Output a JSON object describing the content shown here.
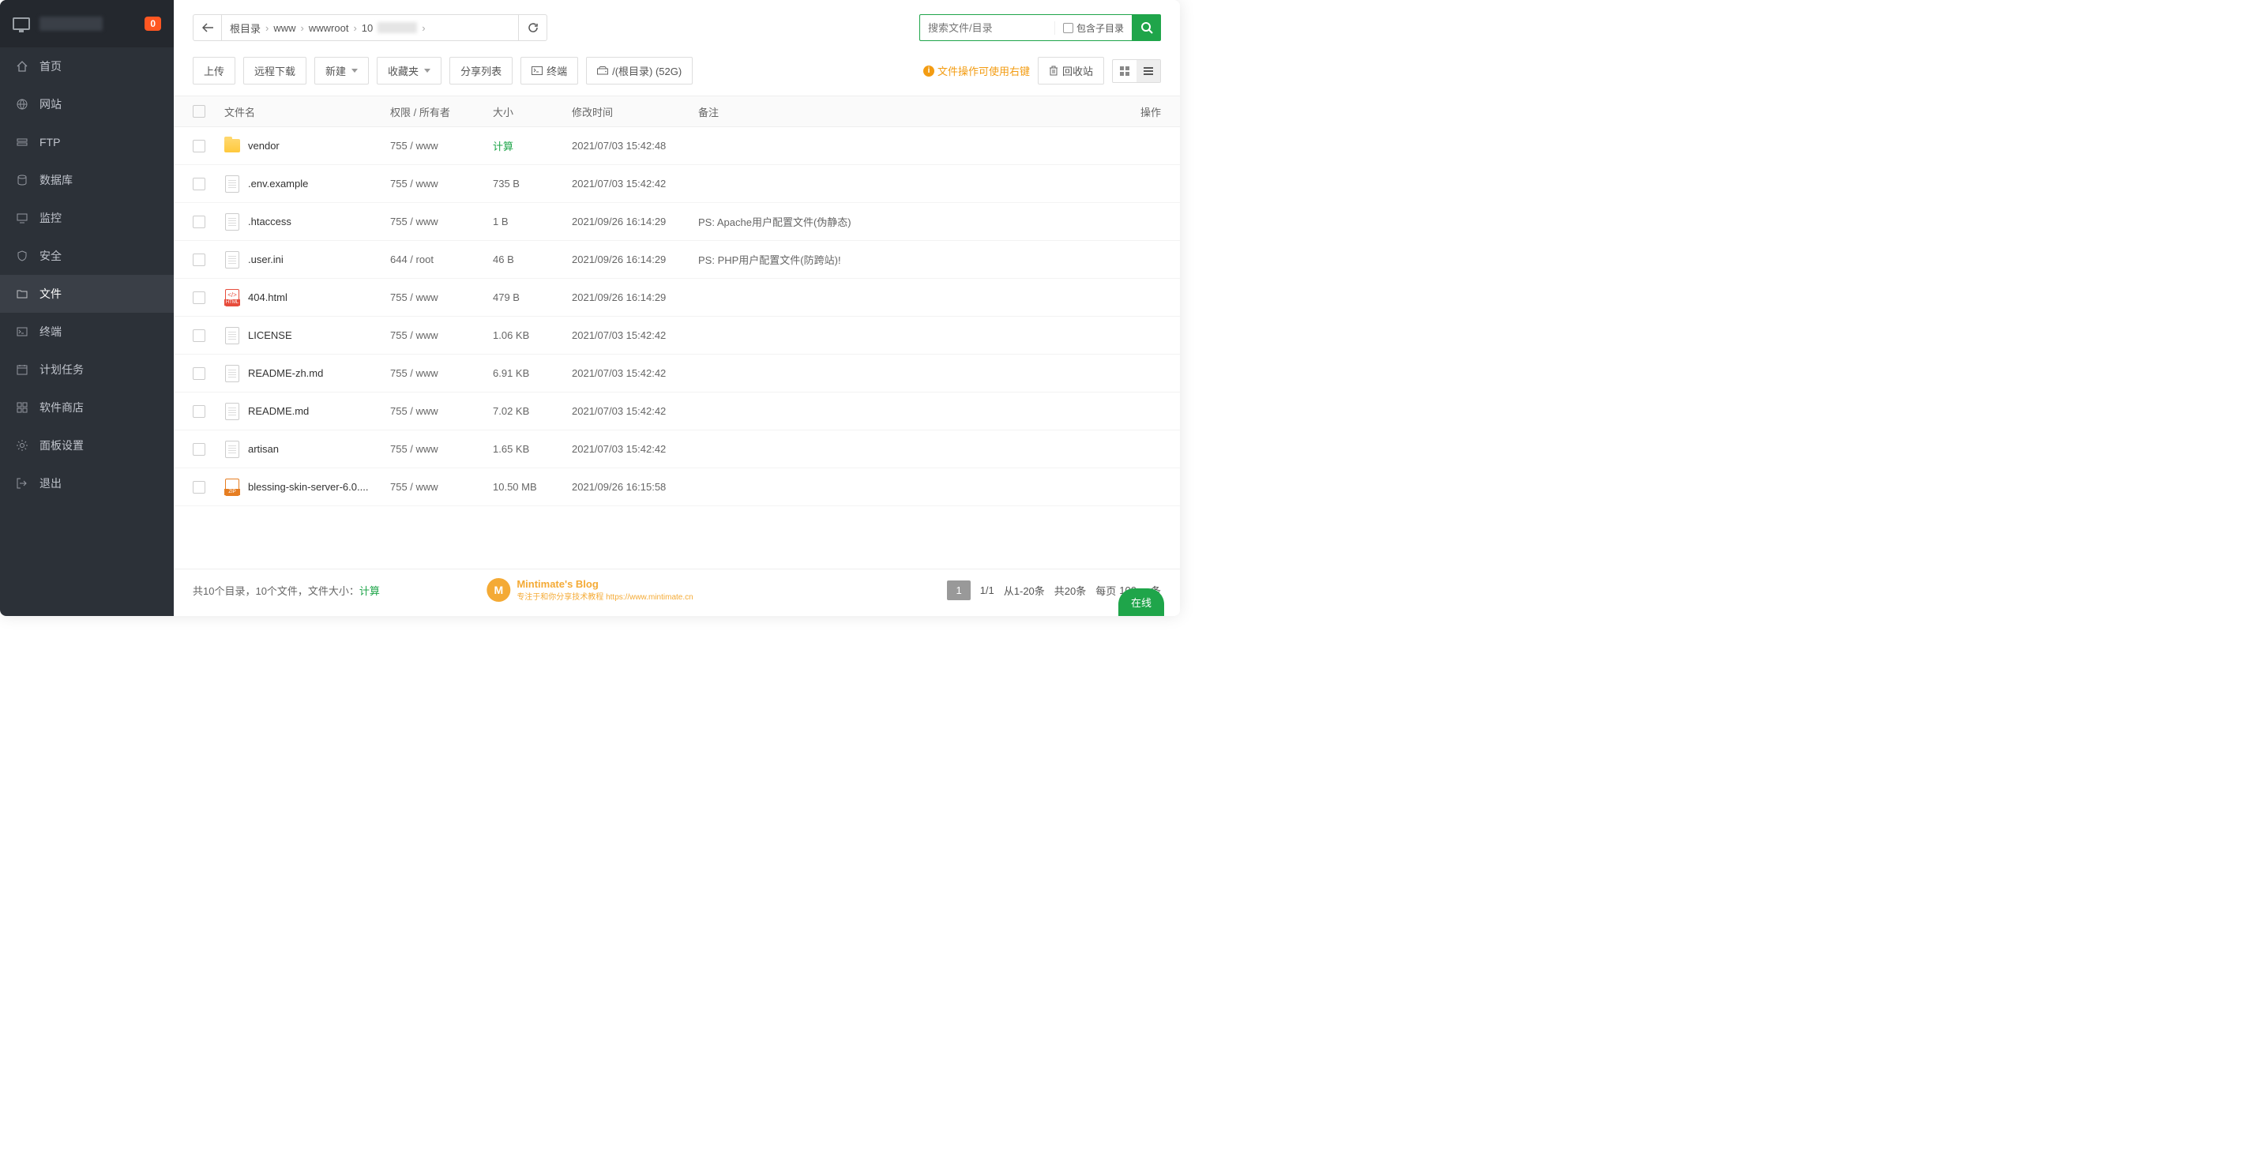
{
  "sidebar": {
    "badge": "0",
    "items": [
      {
        "label": "首页",
        "icon": "home"
      },
      {
        "label": "网站",
        "icon": "globe"
      },
      {
        "label": "FTP",
        "icon": "ftp"
      },
      {
        "label": "数据库",
        "icon": "database"
      },
      {
        "label": "监控",
        "icon": "monitor"
      },
      {
        "label": "安全",
        "icon": "shield"
      },
      {
        "label": "文件",
        "icon": "folder",
        "active": true
      },
      {
        "label": "终端",
        "icon": "terminal"
      },
      {
        "label": "计划任务",
        "icon": "calendar"
      },
      {
        "label": "软件商店",
        "icon": "grid"
      },
      {
        "label": "面板设置",
        "icon": "settings"
      },
      {
        "label": "退出",
        "icon": "logout"
      }
    ]
  },
  "breadcrumb": {
    "segments": [
      "根目录",
      "www",
      "wwwroot",
      "10"
    ],
    "last_blurred": true
  },
  "search": {
    "placeholder": "搜索文件/目录",
    "subdir_label": "包含子目录"
  },
  "toolbar": {
    "upload": "上传",
    "remote_download": "远程下载",
    "new": "新建",
    "favorites": "收藏夹",
    "share_list": "分享列表",
    "terminal": "终端",
    "disk": "/(根目录) (52G)",
    "hint": "文件操作可使用右键",
    "recycle": "回收站"
  },
  "table": {
    "headers": {
      "name": "文件名",
      "perm": "权限 / 所有者",
      "size": "大小",
      "mtime": "修改时间",
      "note": "备注",
      "action": "操作"
    },
    "rows": [
      {
        "icon": "folder",
        "name": "vendor",
        "perm": "755 / www",
        "size": "计算",
        "size_calc": true,
        "mtime": "2021/07/03 15:42:48",
        "note": ""
      },
      {
        "icon": "file",
        "name": ".env.example",
        "perm": "755 / www",
        "size": "735 B",
        "mtime": "2021/07/03 15:42:42",
        "note": ""
      },
      {
        "icon": "file",
        "name": ".htaccess",
        "perm": "755 / www",
        "size": "1 B",
        "mtime": "2021/09/26 16:14:29",
        "note": "PS: Apache用户配置文件(伪静态)"
      },
      {
        "icon": "file",
        "name": ".user.ini",
        "perm": "644 / root",
        "size": "46 B",
        "mtime": "2021/09/26 16:14:29",
        "note": "PS: PHP用户配置文件(防跨站)!"
      },
      {
        "icon": "html",
        "name": "404.html",
        "perm": "755 / www",
        "size": "479 B",
        "mtime": "2021/09/26 16:14:29",
        "note": ""
      },
      {
        "icon": "file",
        "name": "LICENSE",
        "perm": "755 / www",
        "size": "1.06 KB",
        "mtime": "2021/07/03 15:42:42",
        "note": ""
      },
      {
        "icon": "file",
        "name": "README-zh.md",
        "perm": "755 / www",
        "size": "6.91 KB",
        "mtime": "2021/07/03 15:42:42",
        "note": ""
      },
      {
        "icon": "file",
        "name": "README.md",
        "perm": "755 / www",
        "size": "7.02 KB",
        "mtime": "2021/07/03 15:42:42",
        "note": ""
      },
      {
        "icon": "file",
        "name": "artisan",
        "perm": "755 / www",
        "size": "1.65 KB",
        "mtime": "2021/07/03 15:42:42",
        "note": ""
      },
      {
        "icon": "zip",
        "name": "blessing-skin-server-6.0....",
        "perm": "755 / www",
        "size": "10.50 MB",
        "mtime": "2021/09/26 16:15:58",
        "note": ""
      }
    ]
  },
  "footer": {
    "summary_prefix": "共10个目录，10个文件，文件大小：",
    "summary_calc": "计算",
    "pager": {
      "page": "1",
      "pages": "1/1",
      "range": "从1-20条",
      "total": "共20条",
      "per_page_label": "每页",
      "per_page": "100",
      "unit": "条"
    }
  },
  "watermark": {
    "title": "Mintimate's Blog",
    "sub": "专注于和你分享技术教程  https://www.mintimate.cn"
  },
  "online": "在线"
}
